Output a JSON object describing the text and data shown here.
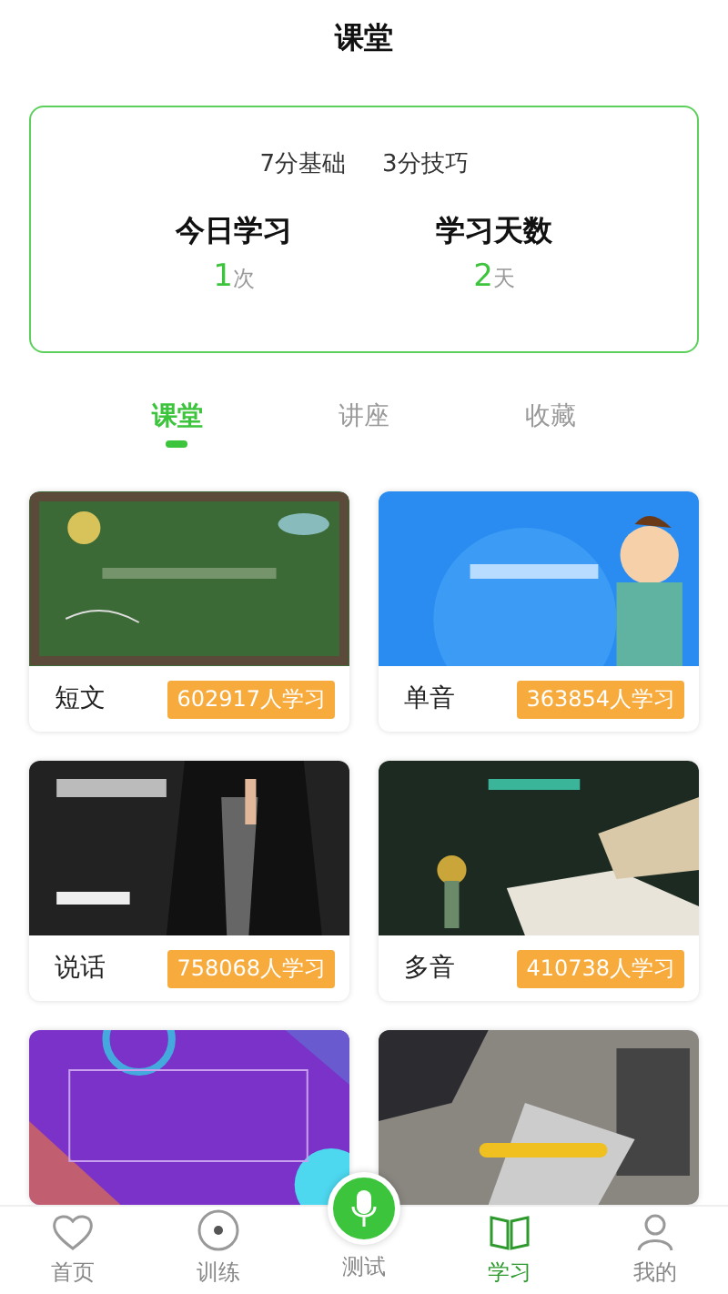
{
  "header": {
    "title": "课堂"
  },
  "summary": {
    "levels": [
      "7分基础",
      "3分技巧"
    ],
    "stats": [
      {
        "label": "今日学习",
        "value": "1",
        "unit": "次"
      },
      {
        "label": "学习天数",
        "value": "2",
        "unit": "天"
      }
    ]
  },
  "tabs": [
    {
      "label": "课堂",
      "selected": true
    },
    {
      "label": "讲座",
      "selected": false
    },
    {
      "label": "收藏",
      "selected": false
    }
  ],
  "courses": [
    {
      "kind": "chalkboard",
      "name": "短文",
      "learners": "602917人学习"
    },
    {
      "kind": "cartoon",
      "name": "单音",
      "learners": "363854人学习"
    },
    {
      "kind": "suit",
      "name": "说话",
      "learners": "758068人学习"
    },
    {
      "kind": "book",
      "name": "多音",
      "learners": "410738人学习"
    },
    {
      "kind": "shapes"
    },
    {
      "kind": "desk"
    }
  ],
  "nav": [
    {
      "kind": "heart",
      "label": "首页",
      "selected": false
    },
    {
      "kind": "target",
      "label": "训练",
      "selected": false
    },
    {
      "kind": "mic",
      "label": "测试",
      "selected": false
    },
    {
      "kind": "book",
      "label": "学习",
      "selected": true
    },
    {
      "kind": "person",
      "label": "我的",
      "selected": false
    }
  ]
}
